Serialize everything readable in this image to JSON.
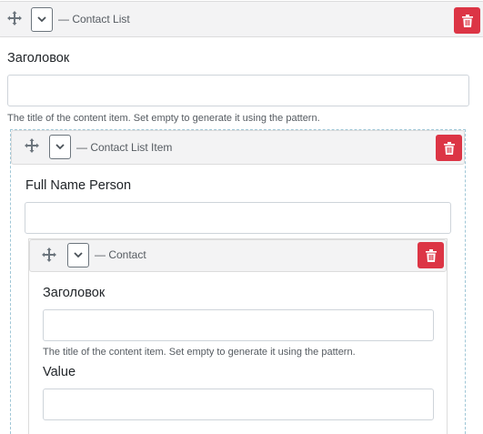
{
  "contact_list": {
    "title": "— Contact List",
    "title_field": {
      "label": "Заголовок",
      "value": "",
      "hint": "The title of the content item. Set empty to generate it using the pattern."
    }
  },
  "contact_list_item": {
    "title": "— Contact List Item",
    "full_name_field": {
      "label": "Full Name Person",
      "value": ""
    }
  },
  "contact": {
    "title": "— Contact",
    "title_field": {
      "label": "Заголовок",
      "value": "",
      "hint": "The title of the content item. Set empty to generate it using the pattern."
    },
    "value_field": {
      "label": "Value",
      "value": ""
    }
  },
  "icons": {
    "move": "move-arrows-icon",
    "toggle": "chevron-down-icon",
    "delete": "trash-icon"
  },
  "colors": {
    "delete_button": "#dc3545",
    "header_bar": "#f3f3f4",
    "nested_frame": "#9fc6d6"
  }
}
